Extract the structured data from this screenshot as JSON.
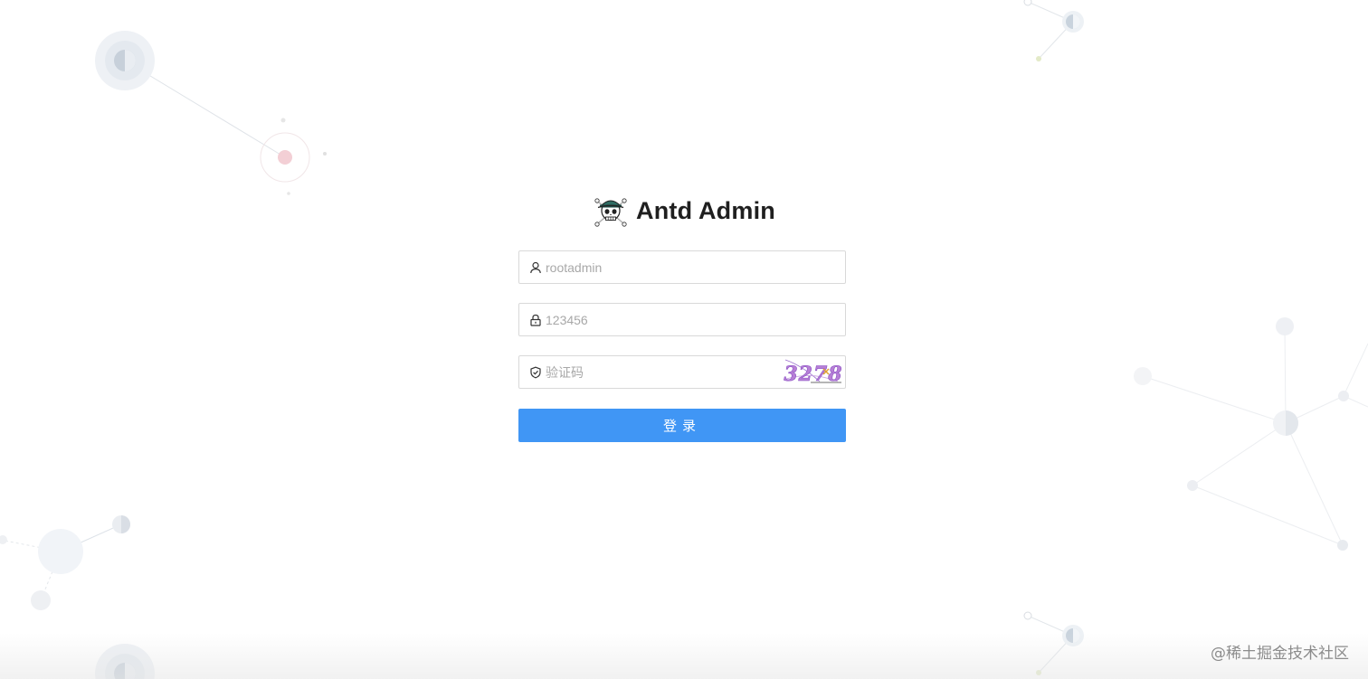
{
  "brand": {
    "title": "Antd Admin",
    "logo_icon": "skull-crossbones-icon"
  },
  "form": {
    "username": {
      "placeholder": "rootadmin",
      "icon": "user-icon"
    },
    "password": {
      "placeholder": "123456",
      "icon": "lock-icon"
    },
    "captcha": {
      "placeholder": "验证码",
      "icon": "safety-shield-icon",
      "image_text": "3278"
    },
    "submit_label": "登录"
  },
  "watermark": "@稀土掘金技术社区",
  "colors": {
    "primary": "#4096f5",
    "border": "#d9d9d9",
    "placeholder": "#a8a8a8",
    "title": "#1f1f1f"
  }
}
